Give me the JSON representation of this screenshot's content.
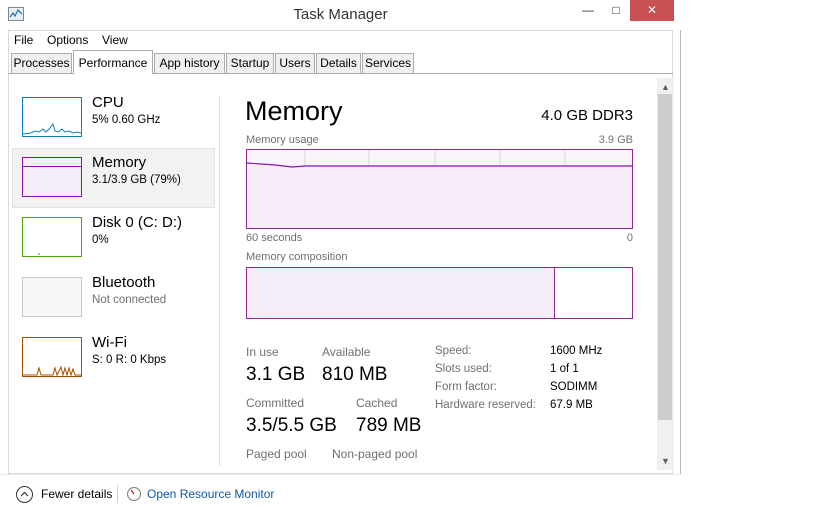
{
  "window": {
    "title": "Task Manager",
    "minimize": "—",
    "maximize": "□",
    "close": "✕"
  },
  "menu": [
    "File",
    "Options",
    "View"
  ],
  "tabs": [
    {
      "label": "Processes",
      "active": false
    },
    {
      "label": "Performance",
      "active": true
    },
    {
      "label": "App history",
      "active": false
    },
    {
      "label": "Startup",
      "active": false
    },
    {
      "label": "Users",
      "active": false
    },
    {
      "label": "Details",
      "active": false
    },
    {
      "label": "Services",
      "active": false
    }
  ],
  "sidebar": {
    "items": [
      {
        "name": "CPU",
        "sub": "5%  0.60 GHz",
        "color": "#117dbb",
        "icon": "cpu-graph-icon"
      },
      {
        "name": "Memory",
        "sub": "3.1/3.9 GB (79%)",
        "color": "#8b12ae",
        "icon": "memory-graph-icon"
      },
      {
        "name": "Disk 0 (C: D:)",
        "sub": "0%",
        "color": "#4da60c",
        "icon": "disk-graph-icon"
      },
      {
        "name": "Bluetooth",
        "sub": "Not connected",
        "color": "#c8c8c8",
        "icon": "bluetooth-graph-icon"
      },
      {
        "name": "Wi-Fi",
        "sub": "S: 0  R: 0 Kbps",
        "color": "#a74f01",
        "icon": "wifi-graph-icon"
      }
    ]
  },
  "main": {
    "title": "Memory",
    "spec": "4.0 GB DDR3",
    "usage_label": "Memory usage",
    "usage_max": "3.9 GB",
    "time_left": "60 seconds",
    "time_right": "0",
    "composition_label": "Memory composition",
    "usage_fraction": 0.79,
    "composition_in_use_fraction": 0.8,
    "stats": {
      "in_use_label": "In use",
      "in_use_value": "3.1 GB",
      "available_label": "Available",
      "available_value": "810 MB",
      "committed_label": "Committed",
      "committed_value": "3.5/5.5 GB",
      "cached_label": "Cached",
      "cached_value": "789 MB",
      "paged_label": "Paged pool",
      "nonpaged_label": "Non-paged pool"
    },
    "details": [
      {
        "label": "Speed:",
        "value": "1600 MHz"
      },
      {
        "label": "Slots used:",
        "value": "1 of 1"
      },
      {
        "label": "Form factor:",
        "value": "SODIMM"
      },
      {
        "label": "Hardware reserved:",
        "value": "67.9 MB"
      }
    ]
  },
  "footer": {
    "fewer_details": "Fewer details",
    "resource_monitor": "Open Resource Monitor"
  },
  "colors": {
    "memory": "#8b12ae",
    "memory_border": "#8e2b96",
    "link": "#0e5aa6"
  }
}
